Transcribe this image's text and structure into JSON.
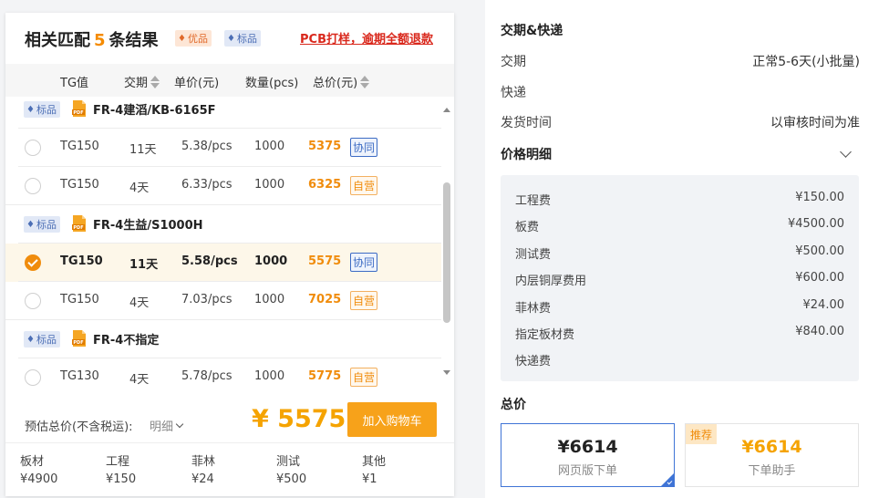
{
  "left": {
    "title_prefix": "相关匹配",
    "title_count": "5",
    "title_suffix": "条结果",
    "tag_you": "优品",
    "tag_biao": "标品",
    "promo": "PCB打样，逾期全额退款",
    "columns": {
      "tg": "TG值",
      "days": "交期",
      "unit_price": "单价(元)",
      "qty": "数量(pcs)",
      "total": "总价(元)"
    },
    "pdf_label": "PDF",
    "groups": [
      {
        "tag": "标品",
        "name": "FR-4建滔/KB-6165F",
        "rows": [
          {
            "tg": "TG150",
            "days": "11天",
            "unit": "5.38/pcs",
            "qty": "1000",
            "total": "5375",
            "badge": "协同",
            "badge_type": "xt",
            "selected": false
          },
          {
            "tg": "TG150",
            "days": "4天",
            "unit": "6.33/pcs",
            "qty": "1000",
            "total": "6325",
            "badge": "自营",
            "badge_type": "zy",
            "selected": false
          }
        ]
      },
      {
        "tag": "标品",
        "name": "FR-4生益/S1000H",
        "rows": [
          {
            "tg": "TG150",
            "days": "11天",
            "unit": "5.58/pcs",
            "qty": "1000",
            "total": "5575",
            "badge": "协同",
            "badge_type": "xt",
            "selected": true
          },
          {
            "tg": "TG150",
            "days": "4天",
            "unit": "7.03/pcs",
            "qty": "1000",
            "total": "7025",
            "badge": "自营",
            "badge_type": "zy",
            "selected": false
          }
        ]
      },
      {
        "tag": "标品",
        "name": "FR-4不指定",
        "rows": [
          {
            "tg": "TG130",
            "days": "4天",
            "unit": "5.78/pcs",
            "qty": "1000",
            "total": "5775",
            "badge": "自营",
            "badge_type": "zy",
            "selected": false
          }
        ]
      }
    ],
    "summary": {
      "est_label": "预估总价(不含税运):",
      "detail_link": "明细",
      "total": "¥ 5575",
      "cart_button": "加入购物车"
    },
    "breakdown": [
      {
        "name": "板材",
        "value": "¥4900"
      },
      {
        "name": "工程",
        "value": "¥150"
      },
      {
        "name": "菲林",
        "value": "¥24"
      },
      {
        "name": "测试",
        "value": "¥500"
      },
      {
        "name": "其他",
        "value": "¥1"
      }
    ]
  },
  "right": {
    "delivery_heading": "交期&快递",
    "delivery_label": "交期",
    "delivery_value": "正常5-6天(小批量)",
    "express_label": "快递",
    "ship_label": "发货时间",
    "ship_value": "以审核时间为准",
    "price_heading": "价格明细",
    "price_items": [
      {
        "name": "工程费",
        "value": "¥150.00"
      },
      {
        "name": "板费",
        "value": "¥4500.00"
      },
      {
        "name": "测试费",
        "value": "¥500.00"
      },
      {
        "name": "内层铜厚费用",
        "value": "¥600.00"
      },
      {
        "name": "菲林费",
        "value": "¥24.00"
      },
      {
        "name": "指定板材费",
        "value": "¥840.00"
      },
      {
        "name": "快递费",
        "value": ""
      }
    ],
    "total_heading": "总价",
    "options": {
      "web_amount": "¥6614",
      "web_caption": "网页版下单",
      "helper_tag": "推荐",
      "helper_amount": "¥6614",
      "helper_caption": "下单助手"
    }
  },
  "colors": {
    "accent_orange": "#f08c0c",
    "price_orange": "#f5a300",
    "promo_red": "#d9281c",
    "select_blue": "#3f74d6"
  }
}
